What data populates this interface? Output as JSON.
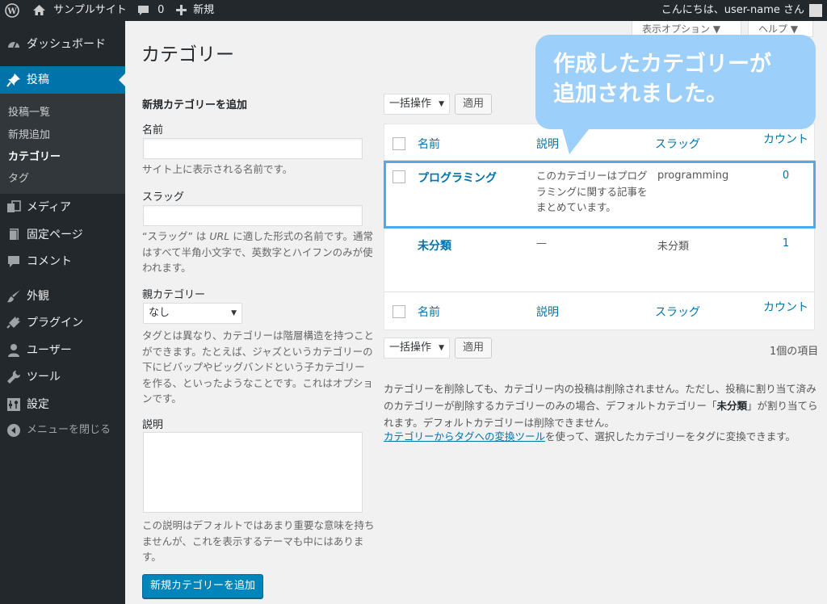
{
  "admin_bar": {
    "site_name": "サンプルサイト",
    "comments_count": "0",
    "new_label": "新規",
    "greeting": "こんにちは、user-name さん"
  },
  "sidebar": {
    "items": [
      {
        "label": "ダッシュボード",
        "icon": "dashboard-icon"
      },
      {
        "label": "投稿",
        "icon": "pin-icon"
      },
      {
        "label": "メディア",
        "icon": "media-icon"
      },
      {
        "label": "固定ページ",
        "icon": "page-icon"
      },
      {
        "label": "コメント",
        "icon": "comment-icon"
      },
      {
        "label": "外観",
        "icon": "brush-icon"
      },
      {
        "label": "プラグイン",
        "icon": "plugin-icon"
      },
      {
        "label": "ユーザー",
        "icon": "user-icon"
      },
      {
        "label": "ツール",
        "icon": "wrench-icon"
      },
      {
        "label": "設定",
        "icon": "settings-icon"
      },
      {
        "label": "メニューを閉じる",
        "icon": "collapse-icon"
      }
    ],
    "submenu": [
      "投稿一覧",
      "新規追加",
      "カテゴリー",
      "タグ"
    ]
  },
  "screen_tabs": {
    "options": "表示オプション ▼",
    "help": "ヘルプ ▼"
  },
  "page_title": "カテゴリー",
  "form": {
    "heading": "新規カテゴリーを追加",
    "name_label": "名前",
    "name_value": "",
    "name_help": "サイト上に表示される名前です。",
    "slug_label": "スラッグ",
    "slug_value": "",
    "slug_help_1": "“スラッグ” は ",
    "slug_help_url": "URL",
    "slug_help_2": " に適した形式の名前です。通常はすべて半角小文字で、英数字とハイフンのみが使われます。",
    "parent_label": "親カテゴリー",
    "parent_value": "なし",
    "parent_help": "タグとは異なり、カテゴリーは階層構造を持つことができます。たとえば、ジャズというカテゴリーの下にビバップやビッグバンドという子カテゴリーを作る、といったようなことです。これはオプションです。",
    "desc_label": "説明",
    "desc_value": "",
    "desc_help": "この説明はデフォルトではあまり重要な意味を持ちませんが、これを表示するテーマも中にはあります。",
    "submit": "新規カテゴリーを追加"
  },
  "bulk": {
    "action": "一括操作",
    "apply": "適用",
    "items_count": "1個の項目"
  },
  "table": {
    "columns": [
      "名前",
      "説明",
      "スラッグ",
      "カウント"
    ],
    "rows": [
      {
        "name": "プログラミング",
        "description": "このカテゴリーはプログラミングに関する記事をまとめています。",
        "slug": "programming",
        "count": "0"
      },
      {
        "name": "未分類",
        "description": "—",
        "slug": "未分類",
        "count": "1"
      }
    ]
  },
  "notes": {
    "p1_a": "カテゴリーを削除しても、カテゴリー内の投稿は削除されません。ただし、投稿に割り当て済みのカテゴリーが削除するカテゴリーのみの場合、デフォルトカテゴリー「",
    "p1_bold": "未分類",
    "p1_b": "」が割り当てられます。デフォルトカテゴリーは削除できません。",
    "p2_link": "カテゴリーからタグへの変換ツール",
    "p2_rest": "を使って、選択したカテゴリーをタグに変換できます。"
  },
  "callout": {
    "line1": "作成したカテゴリーが",
    "line2": "追加されました。"
  },
  "colors": {
    "admin_bg": "#23282d",
    "accent": "#0073aa",
    "primary_button": "#0085ba",
    "callout": "#9ccffa",
    "highlight": "#52a8e9"
  }
}
